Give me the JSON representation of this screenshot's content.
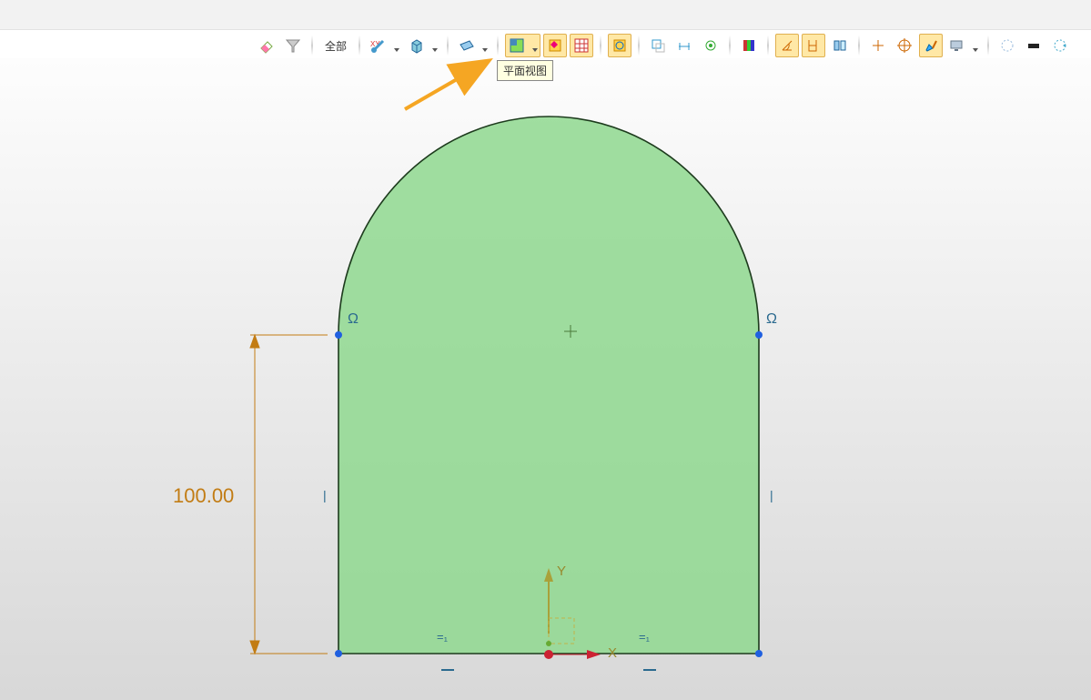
{
  "titlebar": {},
  "toolbar": {
    "filter_label": "全部",
    "tooltip": "平面视图"
  },
  "sketch": {
    "dimension": "100.00",
    "tangent_left": "Ω",
    "tangent_right": "Ω",
    "axis_y": "Y",
    "axis_x": "X",
    "vmark": "|",
    "hmark1": "=₁",
    "hmark2": "=₁",
    "fmark": "–"
  },
  "icons": {
    "eraser": "eraser",
    "funnel": "funnel",
    "wrench": "wrench",
    "cube": "cube",
    "plane": "plane",
    "planview": "planview",
    "snapview": "snapview",
    "hatch": "hatch",
    "fit": "fit",
    "sel": "sel",
    "dim": "dim",
    "constr": "constr",
    "color": "color",
    "ang1": "ang1",
    "ang2": "ang2",
    "mirror": "mirror",
    "plus": "plus",
    "target": "target",
    "brush": "brush",
    "monitor": "monitor",
    "dots": "dots",
    "solid": "solid",
    "cyc": "cyc"
  }
}
